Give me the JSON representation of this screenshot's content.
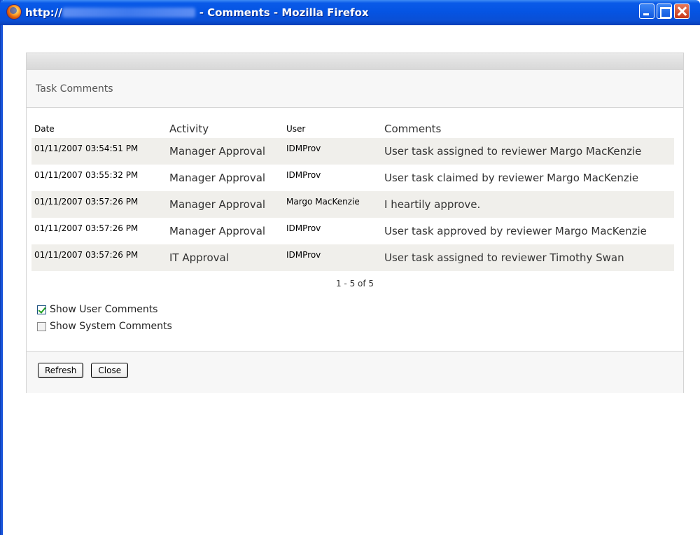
{
  "window": {
    "title_prefix": "http://",
    "title_suffix": " - Comments - Mozilla Firefox"
  },
  "panel": {
    "title": "Task Comments"
  },
  "table": {
    "headers": {
      "date": "Date",
      "activity": "Activity",
      "user": "User",
      "comments": "Comments"
    },
    "rows": [
      {
        "date": "01/11/2007 03:54:51 PM",
        "activity": "Manager Approval",
        "user": "IDMProv",
        "comment": "User task assigned to reviewer Margo MacKenzie"
      },
      {
        "date": "01/11/2007 03:55:32 PM",
        "activity": "Manager Approval",
        "user": "IDMProv",
        "comment": "User task claimed by reviewer Margo MacKenzie"
      },
      {
        "date": "01/11/2007 03:57:26 PM",
        "activity": "Manager Approval",
        "user": "Margo MacKenzie",
        "comment": "I heartily approve."
      },
      {
        "date": "01/11/2007 03:57:26 PM",
        "activity": "Manager Approval",
        "user": "IDMProv",
        "comment": "User task approved by reviewer Margo MacKenzie"
      },
      {
        "date": "01/11/2007 03:57:26 PM",
        "activity": "IT Approval",
        "user": "IDMProv",
        "comment": "User task assigned to reviewer Timothy Swan"
      }
    ]
  },
  "pager": "1 - 5 of 5",
  "options": {
    "show_user_comments": {
      "label": "Show User Comments",
      "checked": true
    },
    "show_system_comments": {
      "label": "Show System Comments",
      "checked": false
    }
  },
  "buttons": {
    "refresh": "Refresh",
    "close": "Close"
  }
}
